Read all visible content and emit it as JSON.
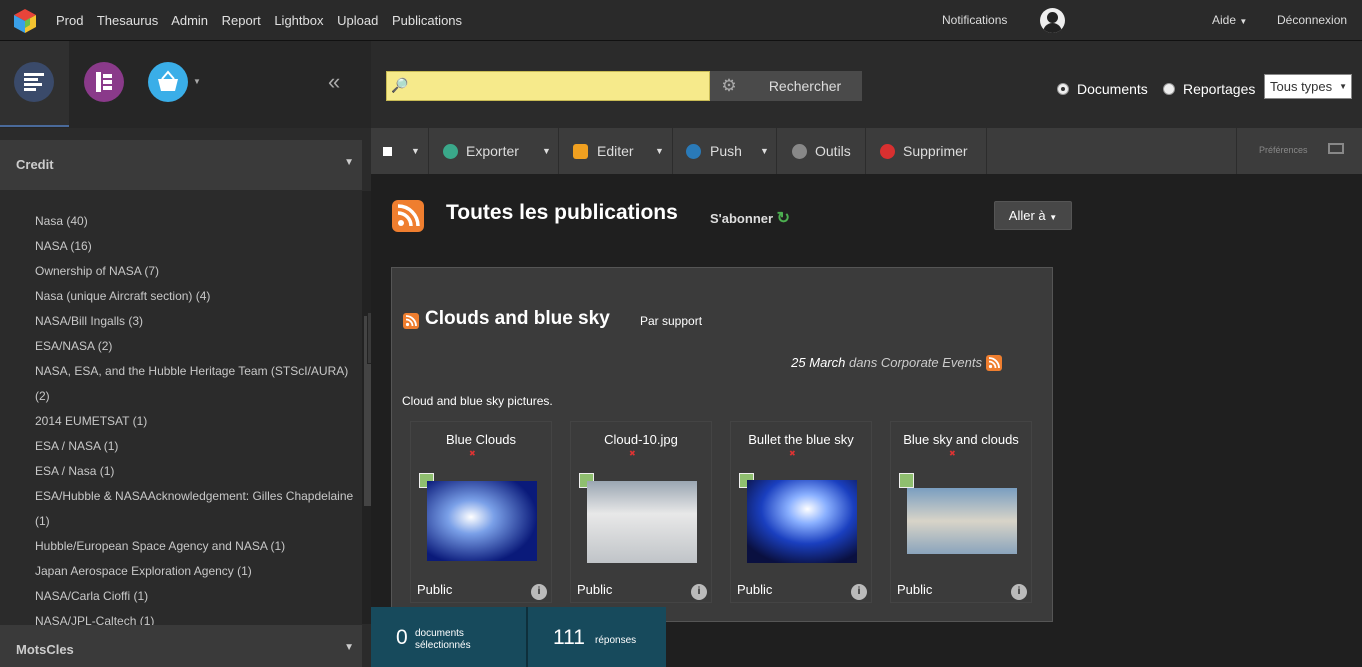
{
  "topnav": {
    "links": [
      "Prod",
      "Thesaurus",
      "Admin",
      "Report",
      "Lightbox",
      "Upload",
      "Publications"
    ],
    "notifications": "Notifications",
    "help": "Aide",
    "logout": "Déconnexion"
  },
  "leftpanel": {
    "collapse": "«",
    "facets": [
      {
        "title": "Credit",
        "items": [
          "Nasa (40)",
          "NASA (16)",
          "Ownership of NASA (7)",
          "Nasa (unique Aircraft section) (4)",
          "NASA/Bill Ingalls (3)",
          "ESA/NASA (2)",
          "NASA, ESA, and the Hubble Heritage Team (STScI/AURA)",
          "(2)",
          "2014 EUMETSAT (1)",
          "ESA / NASA (1)",
          "ESA / Nasa (1)",
          "ESA/Hubble & NASAAcknowledgement: Gilles Chapdelaine",
          "(1)",
          "Hubble/European Space Agency and NASA (1)",
          "Japan Aerospace Exploration Agency (1)",
          "NASA/Carla Cioffi (1)",
          "NASA/JPL-Caltech (1)"
        ]
      },
      {
        "title": "MotsCles"
      }
    ]
  },
  "search": {
    "button": "Rechercher",
    "options": [
      "Documents",
      "Reportages"
    ],
    "selected": "Documents",
    "types": "Tous types"
  },
  "toolbar": {
    "export": "Exporter",
    "edit": "Editer",
    "push": "Push",
    "tools": "Outils",
    "delete": "Supprimer",
    "preferences": "Préférences"
  },
  "page": {
    "title": "Toutes les publications",
    "subscribe": "S'abonner",
    "goto": "Aller à"
  },
  "publication": {
    "title": "Clouds and blue sky",
    "by": "Par support",
    "date": "25 March",
    "in": "dans",
    "category": "Corporate Events",
    "description": "Cloud and blue sky pictures.",
    "items": [
      {
        "title": "Blue Clouds",
        "status": "Public"
      },
      {
        "title": "Cloud-10.jpg",
        "status": "Public"
      },
      {
        "title": "Bullet the blue sky",
        "status": "Public"
      },
      {
        "title": "Blue sky and clouds",
        "status": "Public"
      }
    ]
  },
  "selection": {
    "selected_count": "0",
    "selected_label_1": "documents",
    "selected_label_2": "sélectionnés",
    "answers_count": "111",
    "answers_label": "réponses"
  },
  "colors": {
    "accent_search": "#f6ea8b",
    "rss": "#ef7e2f",
    "selection_bar": "#174a5c"
  }
}
